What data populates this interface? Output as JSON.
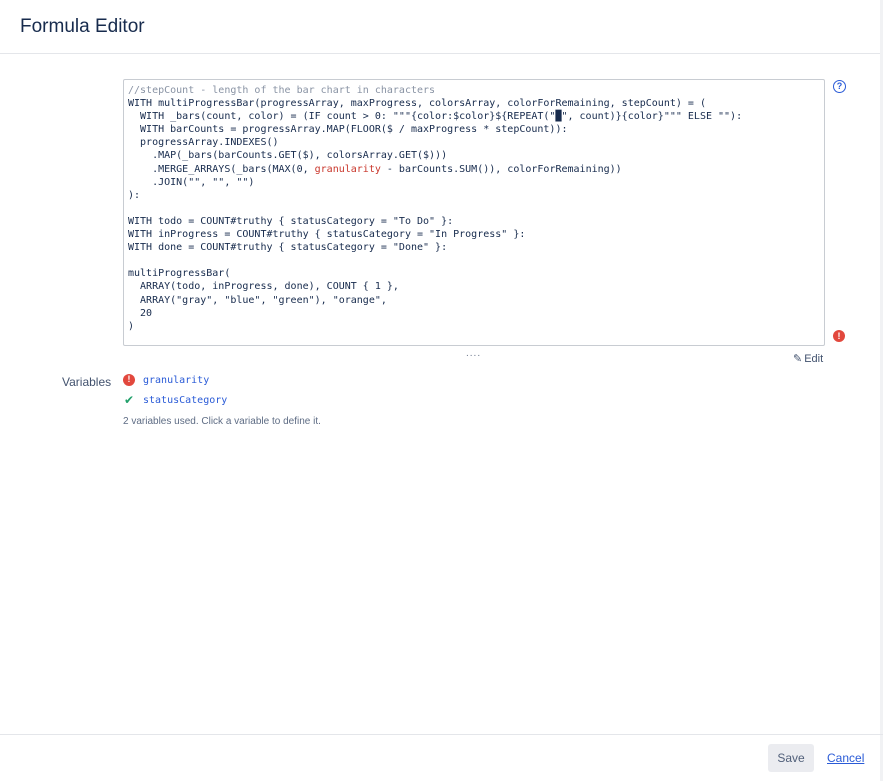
{
  "dialog": {
    "title": "Formula Editor"
  },
  "editor": {
    "lines": [
      [
        {
          "t": "//stepCount - length of the bar chart in characters",
          "c": "comment"
        }
      ],
      [
        {
          "t": "WITH multiProgressBar(progressArray, maxProgress, colorsArray, colorForRemaining, stepCount) = ("
        }
      ],
      [
        {
          "t": "  WITH _bars(count, color) = (IF count > 0: \"\"\"{color:$color}${REPEAT(\"█\", count)}{color}\"\"\" ELSE \"\"):"
        }
      ],
      [
        {
          "t": "  WITH barCounts = progressArray.MAP(FLOOR($ / maxProgress * stepCount)):"
        }
      ],
      [
        {
          "t": "  progressArray.INDEXES()"
        }
      ],
      [
        {
          "t": "    .MAP(_bars(barCounts.GET($), colorsArray.GET($)))"
        }
      ],
      [
        {
          "t": "    .MERGE_ARRAYS(_bars(MAX(0, "
        },
        {
          "t": "granularity",
          "c": "err"
        },
        {
          "t": " - barCounts.SUM()), colorForRemaining))"
        }
      ],
      [
        {
          "t": "    .JOIN(\"\", \"\", \"\")"
        }
      ],
      [
        {
          "t": "):"
        }
      ],
      [
        {
          "t": ""
        }
      ],
      [
        {
          "t": "WITH todo = COUNT#truthy { statusCategory = \"To Do\" }:"
        }
      ],
      [
        {
          "t": "WITH inProgress = COUNT#truthy { statusCategory = \"In Progress\" }:"
        }
      ],
      [
        {
          "t": "WITH done = COUNT#truthy { statusCategory = \"Done\" }:"
        }
      ],
      [
        {
          "t": ""
        }
      ],
      [
        {
          "t": "multiProgressBar("
        }
      ],
      [
        {
          "t": "  ARRAY(todo, inProgress, done), COUNT { 1 },"
        }
      ],
      [
        {
          "t": "  ARRAY(\"gray\", \"blue\", \"green\"), \"orange\","
        }
      ],
      [
        {
          "t": "  20"
        }
      ],
      [
        {
          "t": ")"
        }
      ]
    ],
    "resize_handle": "....",
    "edit_label": "Edit"
  },
  "variables": {
    "label": "Variables",
    "items": [
      {
        "name": "granularity",
        "status": "error"
      },
      {
        "name": "statusCategory",
        "status": "ok"
      }
    ],
    "note": "2 variables used. Click a variable to define it."
  },
  "footer": {
    "save_label": "Save",
    "cancel_label": "Cancel"
  },
  "colors": {
    "accent": "#2a5bd7",
    "error": "#e2483d",
    "ok": "#22a06b"
  }
}
